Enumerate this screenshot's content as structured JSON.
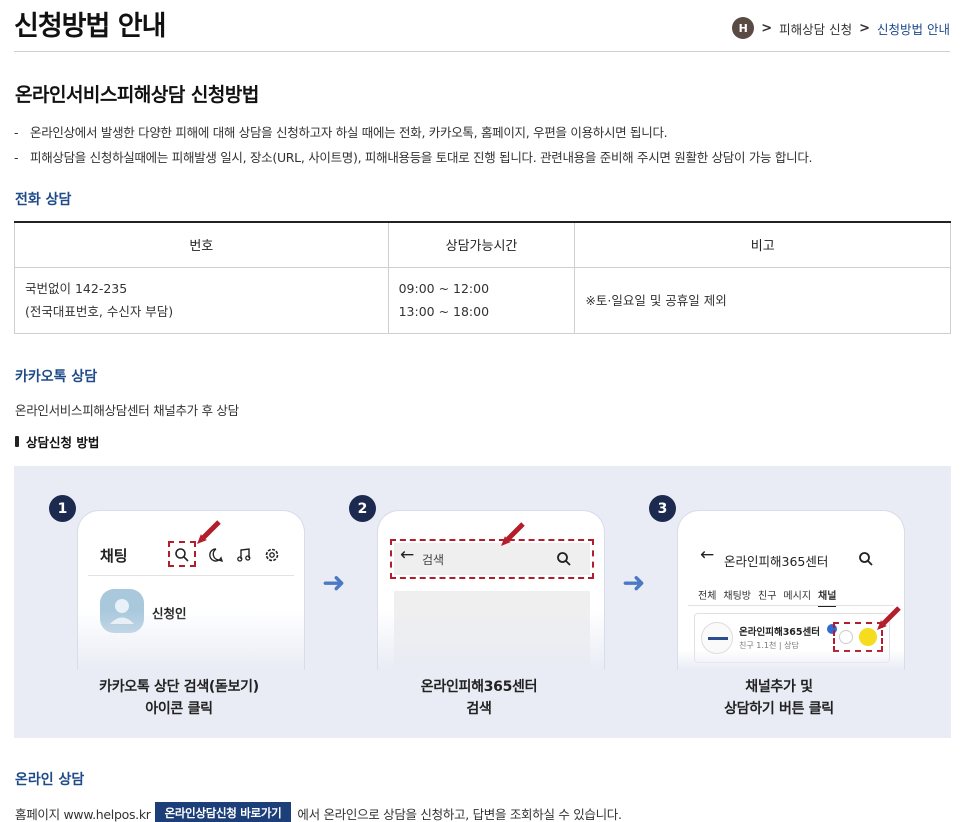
{
  "header": {
    "title": "신청방법 안내",
    "breadcrumb": {
      "home": "H",
      "items": [
        "피해상담 신청",
        "신청방법 안내"
      ]
    }
  },
  "section": {
    "title": "온라인서비스피해상담 신청방법",
    "intro": [
      "온라인상에서 발생한 다양한 피해에 대해 상담을 신청하고자 하실 때에는 전화, 카카오톡, 홈페이지, 우편을 이용하시면 됩니다.",
      "피해상담을 신청하실때에는 피해발생 일시, 장소(URL, 사이트명), 피해내용등을 토대로 진행 됩니다. 관련내용을 준비해 주시면 원활한 상담이 가능 합니다."
    ]
  },
  "phone": {
    "title": "전화 상담",
    "headers": [
      "번호",
      "상담가능시간",
      "비고"
    ],
    "row": {
      "number_line1": "국번없이 142-235",
      "number_line2": "(전국대표번호, 수신자 부담)",
      "time_line1": "09:00 ~ 12:00",
      "time_line2": "13:00 ~ 18:00",
      "note": "※토·일요일 및 공휴일 제외"
    }
  },
  "kakao": {
    "title": "카카오톡 상담",
    "desc": "온라인서비스피해상담센터 채널추가 후 상담",
    "how_title": "상담신청 방법",
    "steps": [
      {
        "num": "1",
        "caption1": "카카오톡 상단 검색(돋보기)",
        "caption2": "아이콘 클릭",
        "screen": {
          "header": "채팅",
          "profile_name": "신청인"
        }
      },
      {
        "num": "2",
        "caption1": "온라인피해365센터",
        "caption2": "검색",
        "screen": {
          "search_text": "검색"
        }
      },
      {
        "num": "3",
        "caption1": "채널추가 및",
        "caption2": "상담하기 버튼 클릭",
        "screen": {
          "search_text": "온라인피해365센터",
          "tabs": [
            "전체",
            "채팅방",
            "친구",
            "메시지",
            "채널"
          ],
          "channel_name": "온라인피해365센터",
          "channel_meta": "친구 1.1천 | 상담"
        }
      }
    ]
  },
  "online": {
    "title": "온라인 상담",
    "prefix": "홈페이지 www.helpos.kr",
    "button": "온라인상담신청 바로가기",
    "suffix": "에서 온라인으로 상담을 신청하고, 답변을 조회하실 수 있습니다."
  }
}
